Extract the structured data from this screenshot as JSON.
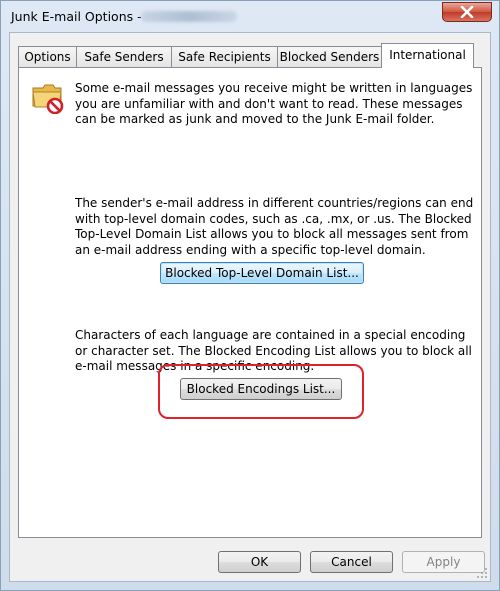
{
  "window": {
    "title": "Junk E-mail Options - "
  },
  "tabs": [
    {
      "label": "Options"
    },
    {
      "label": "Safe Senders"
    },
    {
      "label": "Safe Recipients"
    },
    {
      "label": "Blocked Senders"
    },
    {
      "label": "International"
    }
  ],
  "active_tab": "International",
  "international": {
    "intro": "Some e-mail messages you receive might be written in languages you are unfamiliar with and don't want to read. These messages can be marked as junk and moved to the Junk E-mail folder.",
    "domain_text": "The sender's e-mail address in different countries/regions can end with top-level domain codes, such as .ca, .mx, or .us. The Blocked Top-Level Domain List allows you to block all messages sent from an e-mail address ending with a specific top-level domain.",
    "domain_button": "Blocked Top-Level Domain List...",
    "encoding_text": "Characters of each language are contained in a special encoding or character set. The Blocked Encoding List allows you to block all e-mail messages in a specific encoding.",
    "encoding_button": "Blocked Encodings List..."
  },
  "footer": {
    "ok": "OK",
    "cancel": "Cancel",
    "apply": "Apply"
  },
  "colors": {
    "highlight": "#e0202a",
    "close_button": "#c9462f"
  },
  "icons": {
    "close": "close-x-icon",
    "folder": "junk-folder-blocked-icon"
  }
}
